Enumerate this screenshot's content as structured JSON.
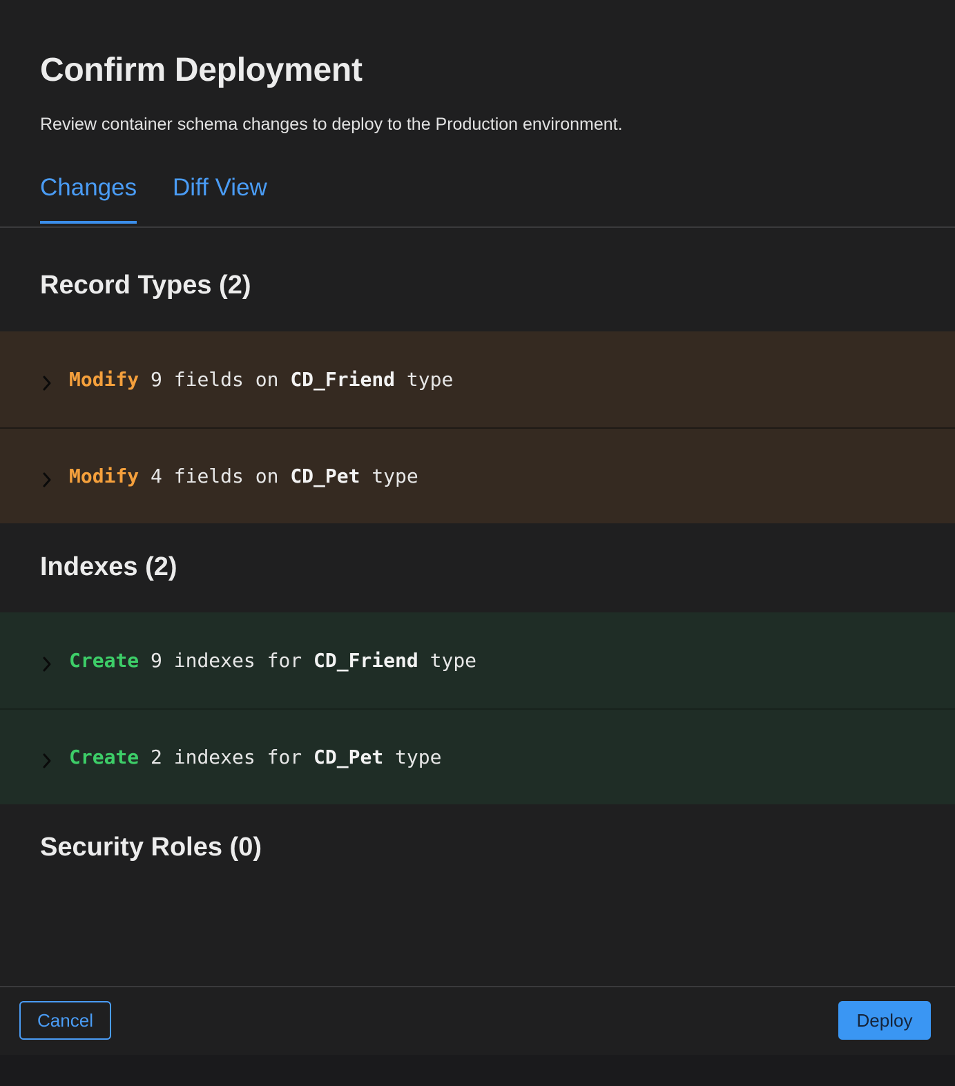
{
  "dialog": {
    "title": "Confirm Deployment",
    "subtitle": "Review container schema changes to deploy to the Production environment."
  },
  "tabs": [
    {
      "label": "Changes",
      "active": true
    },
    {
      "label": "Diff View",
      "active": false
    }
  ],
  "sections": {
    "record_types": {
      "heading": "Record Types (2)",
      "rows": [
        {
          "verb": "Modify",
          "middle": " 9 fields on ",
          "type_name": "CD_Friend",
          "suffix": " type"
        },
        {
          "verb": "Modify",
          "middle": " 4 fields on ",
          "type_name": "CD_Pet",
          "suffix": " type"
        }
      ]
    },
    "indexes": {
      "heading": "Indexes (2)",
      "rows": [
        {
          "verb": "Create",
          "middle": " 9 indexes for ",
          "type_name": "CD_Friend",
          "suffix": " type"
        },
        {
          "verb": "Create",
          "middle": " 2 indexes for ",
          "type_name": "CD_Pet",
          "suffix": " type"
        }
      ]
    },
    "security_roles": {
      "heading": "Security Roles (0)"
    }
  },
  "footer": {
    "cancel_label": "Cancel",
    "deploy_label": "Deploy"
  },
  "colors": {
    "modify": "#f5a03c",
    "create": "#3dce68",
    "accent": "#3a96f3",
    "modify_row_bg": "#352a21",
    "create_row_bg": "#1f2d26"
  },
  "icons": {
    "row_expand": "chevron-right-icon"
  }
}
